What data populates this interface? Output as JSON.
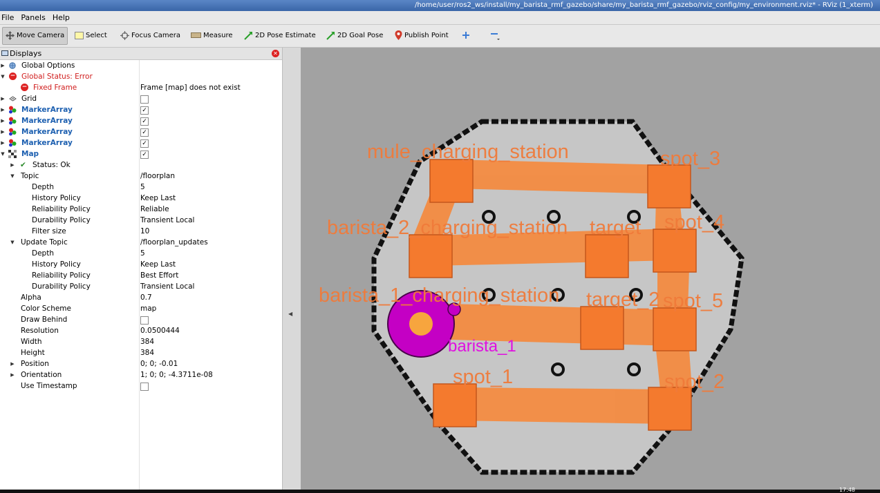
{
  "window": {
    "title": "/home/user/ros2_ws/install/my_barista_rmf_gazebo/share/my_barista_rmf_gazebo/rviz_config/my_environment.rviz* - RViz (1_xterm)"
  },
  "menu": {
    "file": "File",
    "panels": "Panels",
    "help": "Help"
  },
  "toolbar": {
    "move_camera": "Move Camera",
    "select": "Select",
    "focus_camera": "Focus Camera",
    "measure": "Measure",
    "pose_estimate": "2D Pose Estimate",
    "goal_pose": "2D Goal Pose",
    "publish_point": "Publish Point"
  },
  "displays": {
    "title": "Displays",
    "global_options": "Global Options",
    "global_status": "Global Status: Error",
    "fixed_frame": "Fixed Frame",
    "fixed_frame_msg": "Frame [map] does not exist",
    "grid": "Grid",
    "marker_array": "MarkerArray",
    "map": "Map",
    "status_ok": "Status: Ok",
    "topic": "Topic",
    "topic_value": "/floorplan",
    "depth": "Depth",
    "depth_value": "5",
    "history_policy": "History Policy",
    "history_value": "Keep Last",
    "reliability_policy": "Reliability Policy",
    "reliability_value": "Reliable",
    "durability_policy": "Durability Policy",
    "durability_value": "Transient Local",
    "filter_size": "Filter size",
    "filter_size_value": "10",
    "update_topic": "Update Topic",
    "update_topic_value": "/floorplan_updates",
    "update_depth_value": "5",
    "update_history_value": "Keep Last",
    "update_reliability_value": "Best Effort",
    "update_durability_value": "Transient Local",
    "alpha": "Alpha",
    "alpha_value": "0.7",
    "color_scheme": "Color Scheme",
    "color_scheme_value": "map",
    "draw_behind": "Draw Behind",
    "resolution": "Resolution",
    "resolution_value": "0.0500444",
    "width": "Width",
    "width_value": "384",
    "height": "Height",
    "height_value": "384",
    "position": "Position",
    "position_value": "0; 0; -0.01",
    "orientation": "Orientation",
    "orientation_value": "1; 0; 0; -4.3711e-08",
    "use_timestamp": "Use Timestamp"
  },
  "scene": {
    "labels": {
      "mule": "mule_charging_station",
      "spot3": "spot_3",
      "barista2": "barista_2_charging_station",
      "target": "target",
      "spot4": "spot_4",
      "barista1cs": "barista_1_charging_station",
      "target2": "target_2",
      "spot5": "spot_5",
      "robot": "barista_1",
      "spot1": "spot_1",
      "spot2": "spot_2"
    },
    "colors": {
      "waypoint": "#f47a2e",
      "lane": "#f58a3e",
      "robot": "#c400c4",
      "label": "#f07b3a"
    }
  },
  "clock": "17:48"
}
